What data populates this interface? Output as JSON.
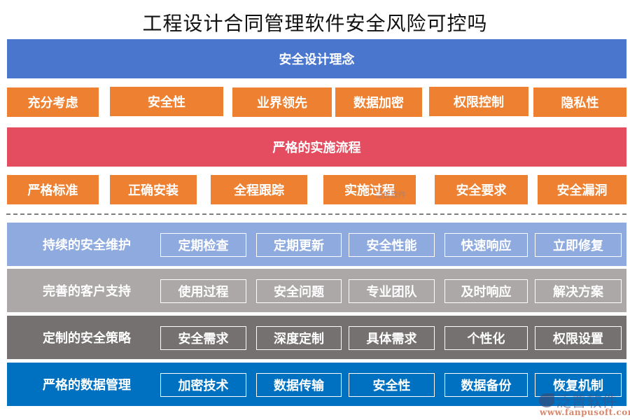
{
  "title": "工程设计合同管理软件安全风险可控吗",
  "colors": {
    "blue_band": "#4a77cd",
    "red_band": "#e44d5f",
    "orange_chip": "#ed8131",
    "divider": "#7f7f7f",
    "row_light_blue": "#8eaade",
    "row_light_gray": "#aca8a7",
    "row_dark_gray": "#767171",
    "row_blue": "#0070c0"
  },
  "section1": {
    "header": "安全设计理念",
    "chips": [
      "充分考虑",
      "安全性",
      "业界领先",
      "数据加密",
      "权限控制",
      "隐私性"
    ]
  },
  "section2": {
    "header": "严格的实施流程",
    "chips": [
      "严格标准",
      "正确安装",
      "全程跟踪",
      "实施过程",
      "安全要求",
      "安全漏洞"
    ]
  },
  "rows": [
    {
      "label": "持续的安全维护",
      "items": [
        "定期检查",
        "定期更新",
        "安全性能",
        "快速响应",
        "立即修复"
      ]
    },
    {
      "label": "完善的客户支持",
      "items": [
        "使用过程",
        "安全问题",
        "专业团队",
        "及时响应",
        "解决方案"
      ]
    },
    {
      "label": "定制的安全策略",
      "items": [
        "安全需求",
        "深度定制",
        "具体需求",
        "个性化",
        "权限设置"
      ]
    },
    {
      "label": "严格的数据管理",
      "items": [
        "加密技术",
        "数据传输",
        "安全性",
        "数据备份",
        "恢复机制"
      ]
    }
  ],
  "watermark": {
    "center_text": "泛普软件",
    "logo_text": "泛普软件",
    "url": "www.fanpusoft.com"
  }
}
